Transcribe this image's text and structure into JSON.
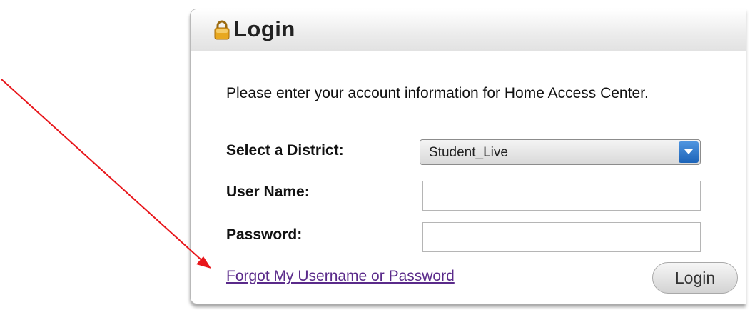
{
  "panel": {
    "title": "Login",
    "intro": "Please enter your account information for Home Access Center."
  },
  "form": {
    "district_label": "Select a District:",
    "district_value": "Student_Live",
    "username_label": "User Name:",
    "username_value": "",
    "password_label": "Password:",
    "password_value": "",
    "forgot_link": "Forgot My Username or Password",
    "login_button": "Login"
  },
  "colors": {
    "annotation_arrow": "#e8161b",
    "link": "#5a2a8a",
    "select_arrow": "#2a72c8",
    "lock": "#e0a020"
  },
  "icons": [
    "lock-icon",
    "dropdown-arrow-icon",
    "annotation-arrow"
  ]
}
